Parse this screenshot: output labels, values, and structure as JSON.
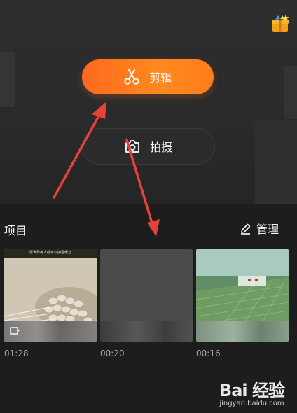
{
  "hero": {
    "edit_label": "剪辑",
    "shoot_label": "拍摄",
    "accent": "#ff7a1e"
  },
  "projects": {
    "title": "项目",
    "manage_label": "管理",
    "items": [
      {
        "duration": "01:28",
        "caption": "愿世界每人都可以拥温暖让"
      },
      {
        "duration": "00:20"
      },
      {
        "duration": "00:16"
      }
    ]
  },
  "watermark": {
    "logo": "Bai 经验",
    "site": "jingyan.baidu.com"
  },
  "icons": [
    "gift-icon",
    "scissors-icon",
    "camera-icon",
    "pencil-icon",
    "video-badge-icon",
    "paw-icon"
  ]
}
